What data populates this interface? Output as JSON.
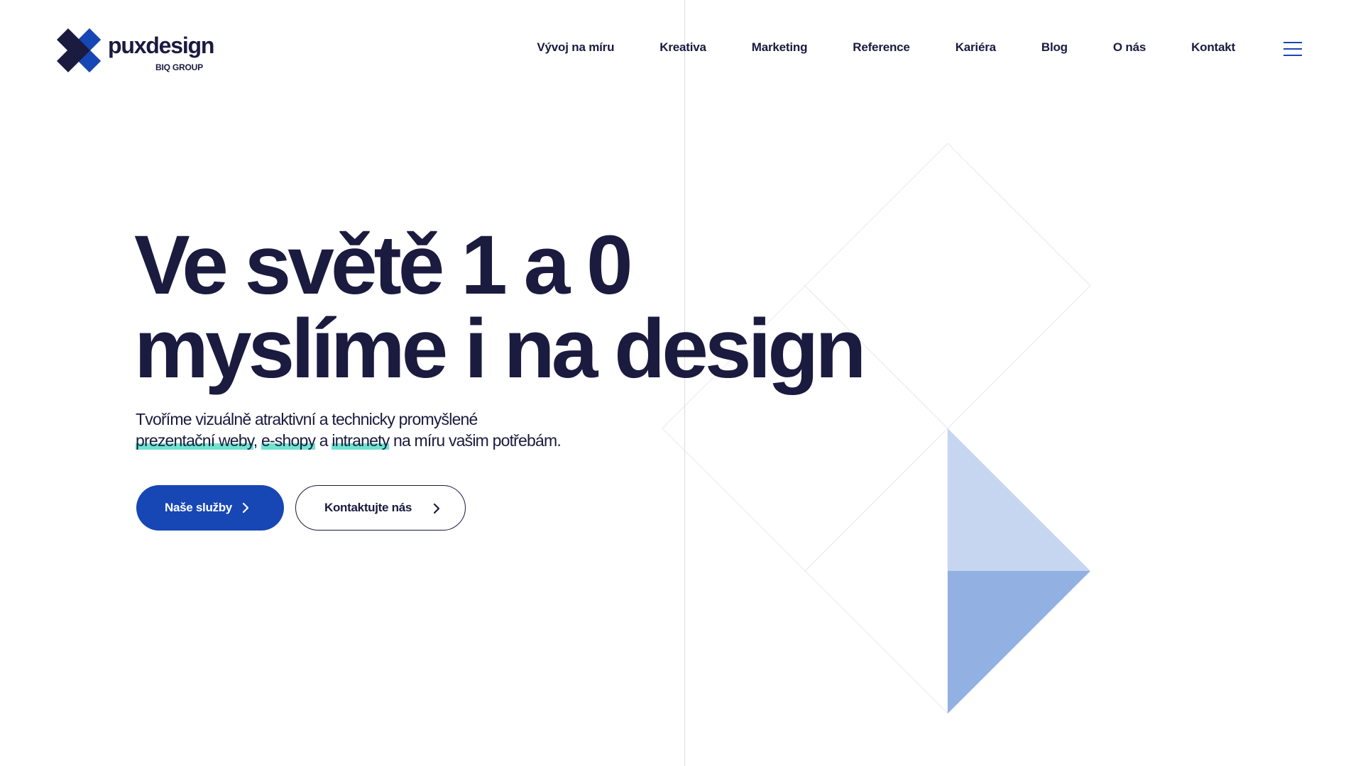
{
  "colors": {
    "brand_blue": "#1746b5",
    "text_dark": "#1b1a3f",
    "highlight": "#6fe3cf",
    "light_blue": "#c6d6f1",
    "mid_blue": "#93b0e2"
  },
  "header": {
    "logo": {
      "wordmark": "puxdesign",
      "subtitle": "BIQ GROUP",
      "icon": "x-logo-icon"
    },
    "nav": [
      {
        "label": "Vývoj na míru"
      },
      {
        "label": "Kreativa"
      },
      {
        "label": "Marketing"
      },
      {
        "label": "Reference"
      },
      {
        "label": "Kariéra"
      },
      {
        "label": "Blog"
      },
      {
        "label": "O nás"
      },
      {
        "label": "Kontakt"
      }
    ],
    "menu_icon": "hamburger-menu-icon"
  },
  "hero": {
    "title_line1": "Ve světě 1 a 0",
    "title_line2": "myslíme i na design",
    "subtitle_line1": "Tvoříme vizuálně atraktivní a technicky promyšlené",
    "subtitle_link1": "prezentační weby",
    "subtitle_sep1": ",",
    "subtitle_link2": "e-shopy",
    "subtitle_and": "a",
    "subtitle_link3": "intranety",
    "subtitle_end": "na míru vašim potřebám.",
    "primary_button": "Naše služby",
    "secondary_button": "Kontaktujte nás",
    "button_icon": "chevron-right-icon"
  }
}
